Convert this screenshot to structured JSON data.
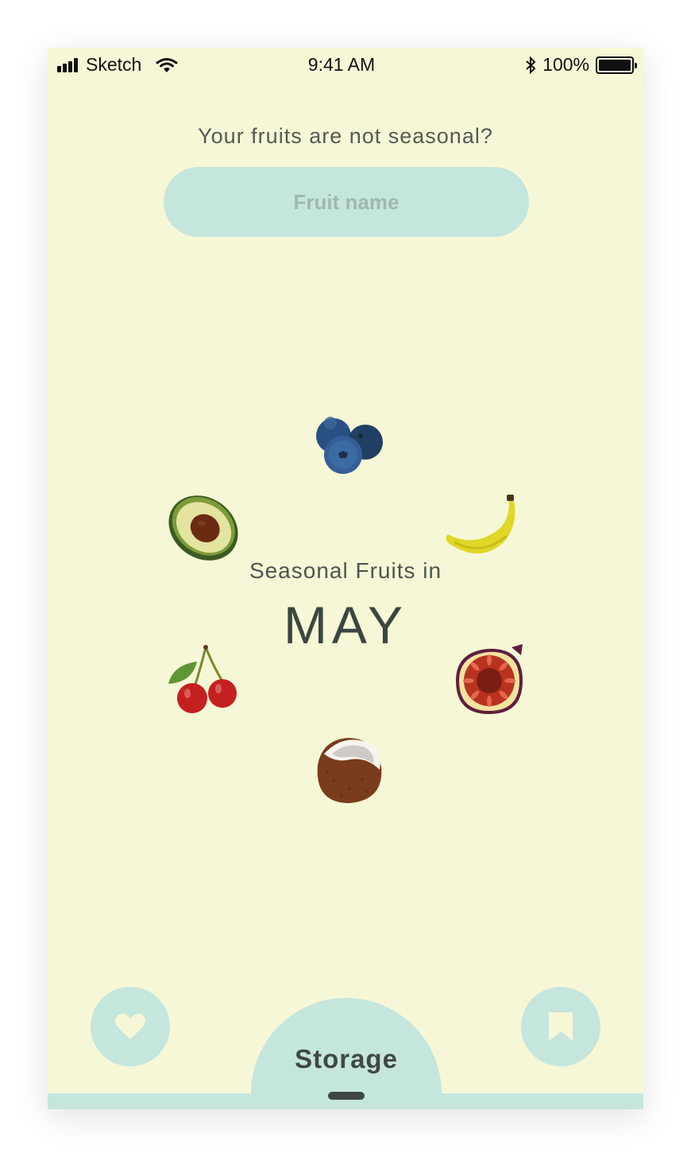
{
  "status_bar": {
    "carrier": "Sketch",
    "time": "9:41 AM",
    "battery": "100%"
  },
  "search": {
    "question": "Your fruits are not seasonal?",
    "placeholder": "Fruit name"
  },
  "season": {
    "subtitle": "Seasonal Fruits in",
    "month": "MAY",
    "fruits": [
      "blueberries-icon",
      "avocado-icon",
      "banana-icon",
      "cherries-icon",
      "fig-icon",
      "coconut-icon"
    ]
  },
  "bottom_nav": {
    "storage_label": "Storage",
    "left_icon": "heart-icon",
    "right_icon": "bookmark-icon"
  },
  "colors": {
    "background": "#f6f7d6",
    "accent": "#c5e6dd",
    "text_dark": "#3f4843"
  }
}
